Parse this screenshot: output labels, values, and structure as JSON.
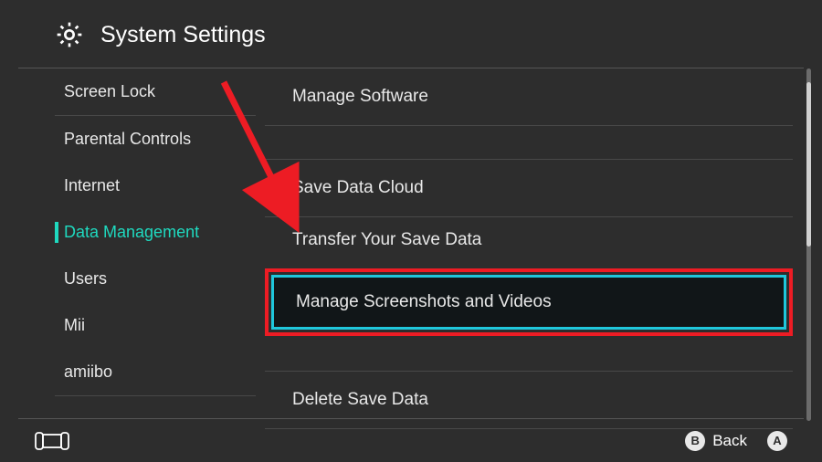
{
  "header": {
    "title": "System Settings"
  },
  "sidebar": {
    "items": [
      {
        "label": "Screen Lock",
        "active": false
      },
      {
        "label": "Parental Controls",
        "active": false
      },
      {
        "label": "Internet",
        "active": false
      },
      {
        "label": "Data Management",
        "active": true
      },
      {
        "label": "Users",
        "active": false
      },
      {
        "label": "Mii",
        "active": false
      },
      {
        "label": "amiibo",
        "active": false
      }
    ]
  },
  "content": {
    "items": [
      {
        "label": "Manage Software",
        "highlighted": false
      },
      {
        "label": "Save Data Cloud",
        "highlighted": false
      },
      {
        "label": "Transfer Your Save Data",
        "highlighted": false
      },
      {
        "label": "Manage Screenshots and Videos",
        "highlighted": true
      },
      {
        "label": "Delete Save Data",
        "highlighted": false
      }
    ]
  },
  "footer": {
    "buttons": [
      {
        "glyph": "B",
        "label": "Back"
      },
      {
        "glyph": "A",
        "label": ""
      }
    ]
  }
}
